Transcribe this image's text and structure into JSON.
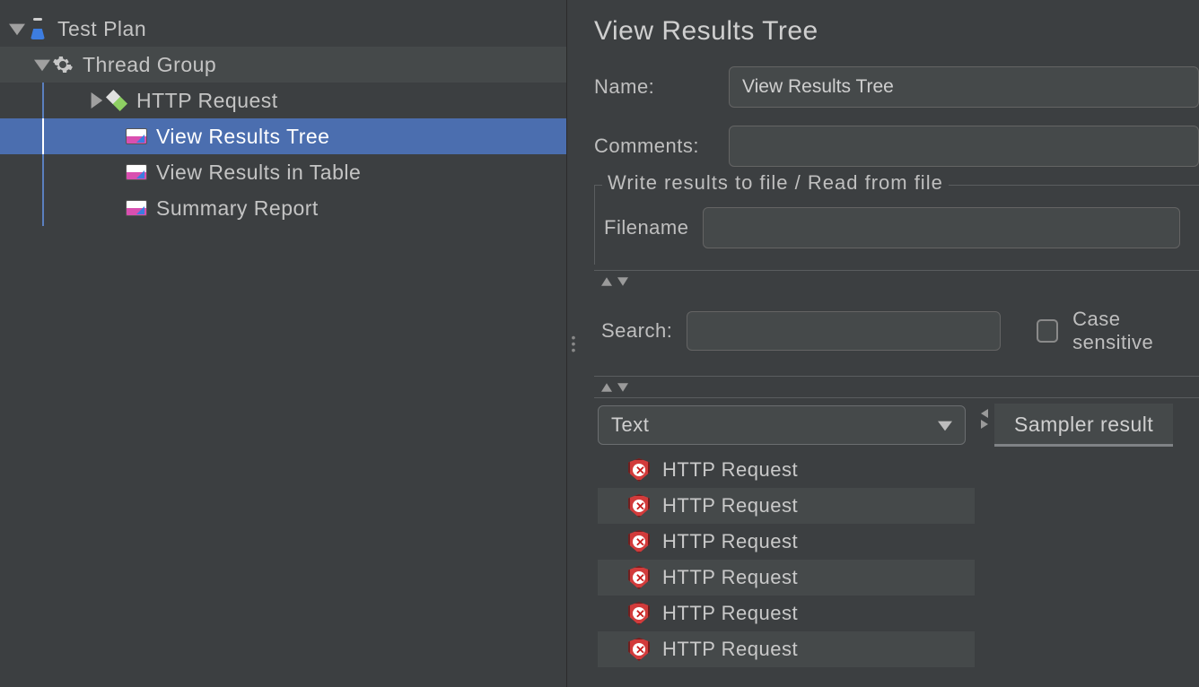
{
  "tree": {
    "test_plan": "Test Plan",
    "thread_group": "Thread Group",
    "http_request": "HTTP Request",
    "view_results_tree": "View Results Tree",
    "view_results_table": "View Results in Table",
    "summary_report": "Summary Report"
  },
  "panel": {
    "title": "View Results Tree",
    "name_label": "Name:",
    "name_value": "View Results Tree",
    "comments_label": "Comments:",
    "comments_value": "",
    "file_legend": "Write results to file / Read from file",
    "filename_label": "Filename",
    "filename_value": "",
    "search_label": "Search:",
    "search_value": "",
    "case_sensitive_label": "Case sensitive",
    "renderer_selected": "Text",
    "tab_sampler_result": "Sampler result"
  },
  "results": [
    {
      "label": "HTTP Request",
      "status": "error"
    },
    {
      "label": "HTTP Request",
      "status": "error"
    },
    {
      "label": "HTTP Request",
      "status": "error"
    },
    {
      "label": "HTTP Request",
      "status": "error"
    },
    {
      "label": "HTTP Request",
      "status": "error"
    },
    {
      "label": "HTTP Request",
      "status": "error"
    }
  ]
}
